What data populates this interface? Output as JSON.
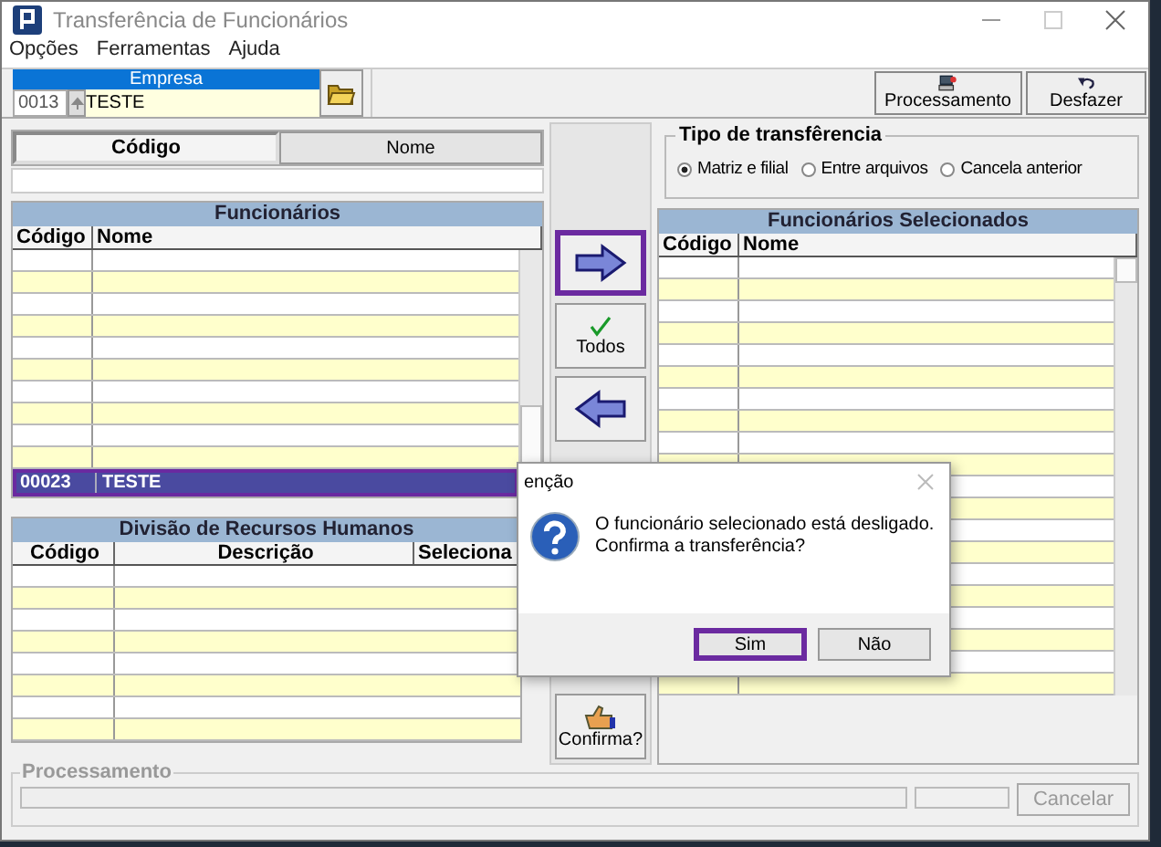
{
  "window": {
    "title": "Transferência de Funcionários"
  },
  "menu": [
    "Opções",
    "Ferramentas",
    "Ajuda"
  ],
  "empresa": {
    "label": "Empresa",
    "code": "0013",
    "name": "TESTE"
  },
  "toolbar": [
    {
      "kind": "process",
      "label": "Processamento"
    },
    {
      "kind": "undo",
      "label": "Desfazer"
    }
  ],
  "search_tabs": [
    {
      "label": "Código",
      "selected": true
    },
    {
      "label": "Nome",
      "selected": false
    }
  ],
  "funcionarios": {
    "title": "Funcionários",
    "columns": [
      "Código",
      "Nome"
    ],
    "rows": [
      {
        "code": "00023",
        "name": "TESTE",
        "selected": true
      }
    ]
  },
  "divisao": {
    "title": "Divisão de Recursos Humanos",
    "columns": [
      "Código",
      "Descrição",
      "Seleciona"
    ]
  },
  "actions": [
    {
      "kind": "add",
      "focused": true
    },
    {
      "kind": "all",
      "label": "Todos",
      "focused": false
    },
    {
      "kind": "remove",
      "focused": false
    },
    {
      "kind": "confirm",
      "label": "Confirma?",
      "focused": false
    }
  ],
  "tipo": {
    "title": "Tipo de transfêrencia",
    "options": [
      {
        "label": "Matriz e filial",
        "selected": true
      },
      {
        "label": "Entre arquivos",
        "selected": false
      },
      {
        "label": "Cancela anterior",
        "selected": false
      }
    ]
  },
  "selecionados": {
    "title": "Funcionários Selecionados",
    "columns": [
      "Código",
      "Nome"
    ]
  },
  "processamento": {
    "title": "Processamento",
    "level": 0,
    "cancel": {
      "label": "Cancelar",
      "disabled": true
    }
  },
  "dialog": {
    "title": "enção",
    "message": [
      "O funcionário selecionado está desligado.",
      "Confirma a transferência?"
    ],
    "buttons": [
      {
        "label": "Sim",
        "focused": true
      },
      {
        "label": "Não",
        "focused": false
      }
    ]
  }
}
